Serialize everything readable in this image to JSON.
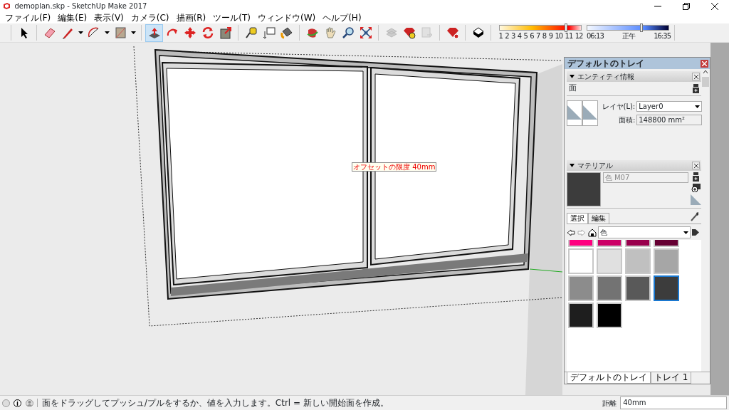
{
  "window": {
    "title": "demoplan.skp - SketchUp Make 2017"
  },
  "menu": [
    "ファイル(F)",
    "編集(E)",
    "表示(V)",
    "カメラ(C)",
    "描画(R)",
    "ツール(T)",
    "ウィンドウ(W)",
    "ヘルプ(H)"
  ],
  "toolbar_groups": [
    [
      {
        "selected": false,
        "dropdown": false,
        "disabled": false
      }
    ],
    [
      {
        "selected": false,
        "dropdown": false,
        "disabled": false
      },
      {
        "selected": false,
        "dropdown": true,
        "disabled": false
      },
      {
        "selected": false,
        "dropdown": true,
        "disabled": false
      },
      {
        "selected": false,
        "dropdown": true,
        "disabled": false
      }
    ],
    [
      {
        "selected": true,
        "dropdown": false,
        "disabled": false
      },
      {
        "selected": false,
        "dropdown": false,
        "disabled": false
      },
      {
        "selected": false,
        "dropdown": false,
        "disabled": false
      },
      {
        "selected": false,
        "dropdown": false,
        "disabled": false
      },
      {
        "selected": false,
        "dropdown": false,
        "disabled": false
      }
    ],
    [
      {
        "selected": false,
        "dropdown": false,
        "disabled": false
      },
      {
        "selected": false,
        "dropdown": false,
        "disabled": false
      },
      {
        "selected": false,
        "dropdown": false,
        "disabled": false
      }
    ],
    [
      {
        "selected": false,
        "dropdown": false,
        "disabled": false
      },
      {
        "selected": false,
        "dropdown": false,
        "disabled": false
      },
      {
        "selected": false,
        "dropdown": false,
        "disabled": false
      },
      {
        "selected": false,
        "dropdown": false,
        "disabled": false
      }
    ],
    [
      {
        "selected": false,
        "dropdown": false,
        "disabled": true
      },
      {
        "selected": false,
        "dropdown": false,
        "disabled": false
      },
      {
        "selected": false,
        "dropdown": false,
        "disabled": true
      }
    ],
    [
      {
        "selected": false,
        "dropdown": false,
        "disabled": false
      }
    ],
    [
      {
        "selected": false,
        "dropdown": false,
        "disabled": false
      }
    ]
  ],
  "shadow_settings": {
    "month_slider": {
      "level": 0.87,
      "labels": [
        "1",
        "2",
        "3",
        "4",
        "5",
        "6",
        "7",
        "8",
        "9",
        "10",
        "11",
        "12"
      ]
    },
    "time_slider": {
      "level": 0.71,
      "labels": [
        "06:13",
        "正午",
        "16:35"
      ]
    }
  },
  "viewport": {
    "tooltip": "オフセットの限度 40mm"
  },
  "tray": {
    "title": "デフォルトのトレイ",
    "entity_info": {
      "title": "エンティティ情報",
      "expanded": true,
      "entity_type": "面",
      "layer_label": "レイヤ(L):",
      "layer_value": "Layer0",
      "area_label": "面積:",
      "area_value": "148800 mm²"
    },
    "materials": {
      "title": "マテリアル",
      "expanded": true,
      "name": "色 M07",
      "tabs": [
        {
          "label": "選択",
          "selected": true
        },
        {
          "label": "編集",
          "selected": false
        }
      ],
      "library": "色",
      "swatches": [
        {
          "color": "#ff0080",
          "selected": false
        },
        {
          "color": "#cc0066",
          "selected": false
        },
        {
          "color": "#99004d",
          "selected": false
        },
        {
          "color": "#660033",
          "selected": false
        },
        {
          "color": "#ffffff",
          "selected": false
        },
        {
          "color": "#e0e0e0",
          "selected": false
        },
        {
          "color": "#c0c0c0",
          "selected": false
        },
        {
          "color": "#a6a6a6",
          "selected": false
        },
        {
          "color": "#8c8c8c",
          "selected": false
        },
        {
          "color": "#737373",
          "selected": false
        },
        {
          "color": "#595959",
          "selected": false
        },
        {
          "color": "#3c3c3c",
          "selected": true
        },
        {
          "color": "#1e1e1e",
          "selected": false
        },
        {
          "color": "#000000",
          "selected": false
        }
      ]
    },
    "tabs": [
      {
        "label": "デフォルトのトレイ",
        "selected": true
      },
      {
        "label": "トレイ 1",
        "selected": false
      }
    ]
  },
  "status_bar": {
    "message": "面をドラッグしてプッシュ/プルをするか、値を入力します。Ctrl = 新しい開始面を作成。",
    "measure_label": "距離",
    "measure_value": "40mm"
  }
}
